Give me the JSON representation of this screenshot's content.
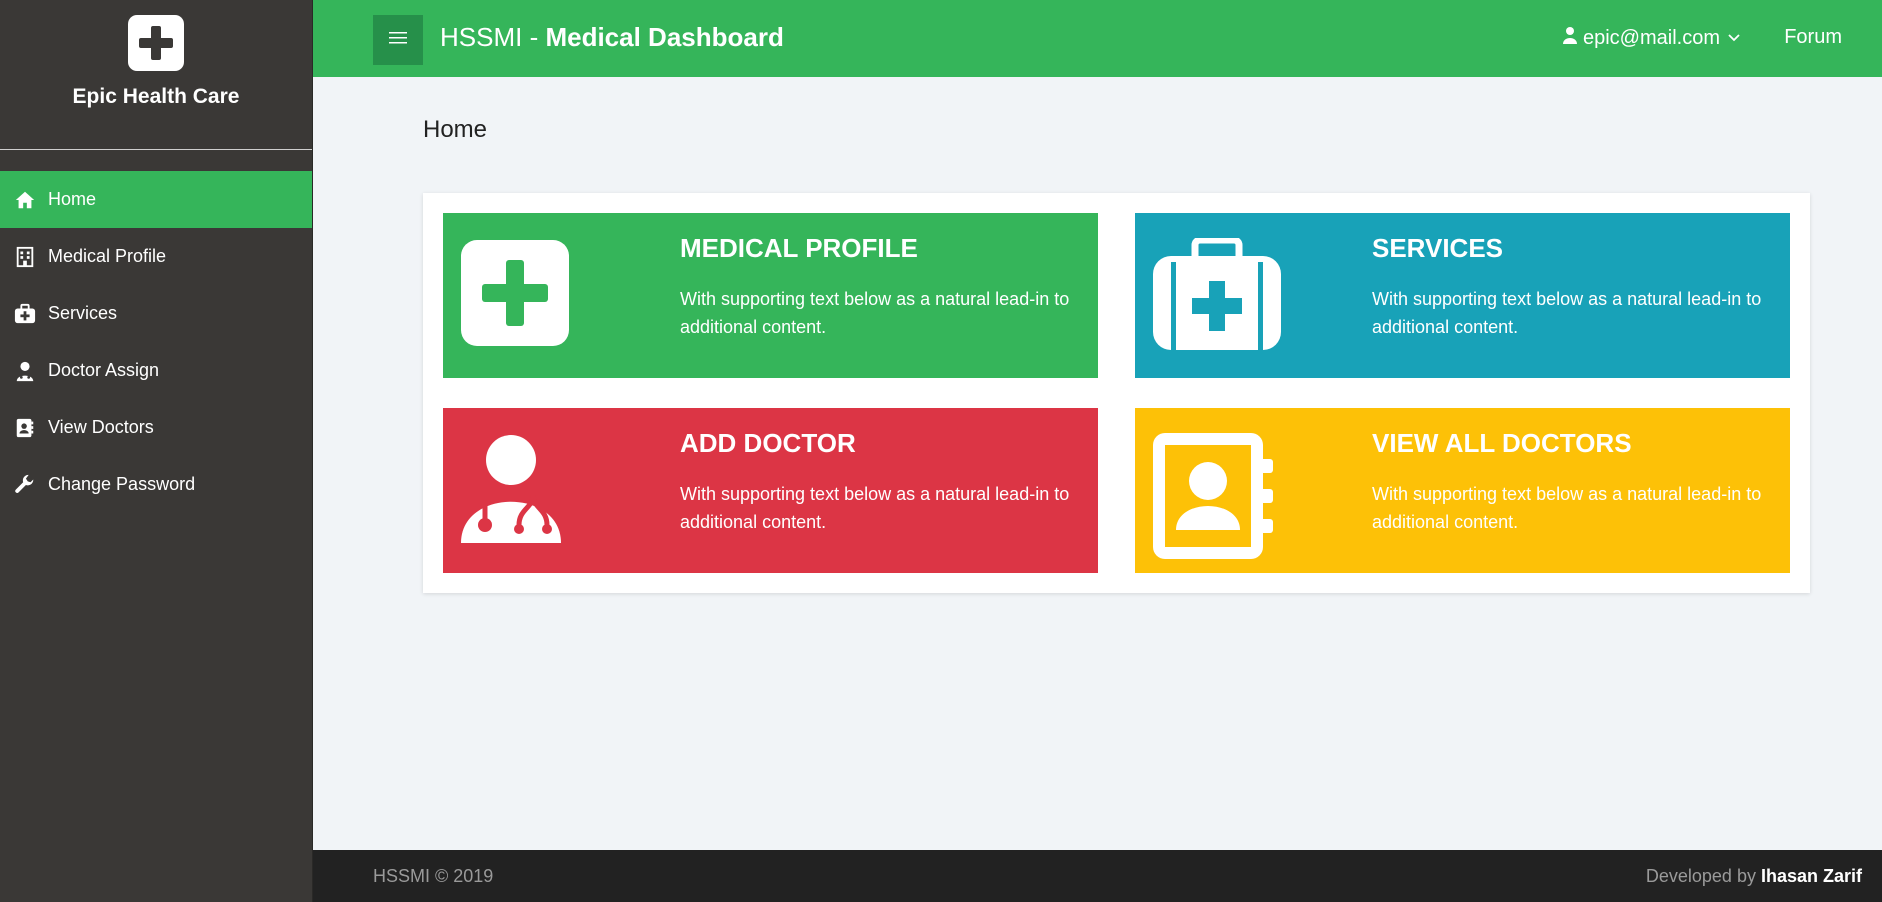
{
  "brand": {
    "name": "Epic Health Care",
    "logo_icon": "plus-icon"
  },
  "sidebar": {
    "items": [
      {
        "label": "Home",
        "icon": "home-icon",
        "active": true
      },
      {
        "label": "Medical Profile",
        "icon": "hospital-icon"
      },
      {
        "label": "Services",
        "icon": "medkit-icon"
      },
      {
        "label": "Doctor Assign",
        "icon": "doctor-icon"
      },
      {
        "label": "View Doctors",
        "icon": "address-book-icon"
      },
      {
        "label": "Change Password",
        "icon": "wrench-icon"
      }
    ]
  },
  "header": {
    "title_prefix": "HSSMI - ",
    "title_bold": "Medical Dashboard",
    "user_email": "epic@mail.com",
    "forum_label": "Forum"
  },
  "main": {
    "page_title": "Home",
    "tiles": [
      {
        "title": "MEDICAL PROFILE",
        "text": "With supporting text below as a natural lead-in to additional content.",
        "color": "#35b55a",
        "icon": "plus-square-icon"
      },
      {
        "title": "SERVICES",
        "text": "With supporting text below as a natural lead-in to additional content.",
        "color": "#18a2b8",
        "icon": "medkit-icon"
      },
      {
        "title": "ADD DOCTOR",
        "text": "With supporting text below as a natural lead-in to additional content.",
        "color": "#dc3545",
        "icon": "doctor-icon"
      },
      {
        "title": "VIEW ALL DOCTORS",
        "text": "With supporting text below as a natural lead-in to additional content.",
        "color": "#fdc107",
        "icon": "address-book-icon"
      }
    ]
  },
  "footer": {
    "copyright": "HSSMI © 2019",
    "developed_by": "Developed by",
    "developer": "Ihasan Zarif"
  }
}
